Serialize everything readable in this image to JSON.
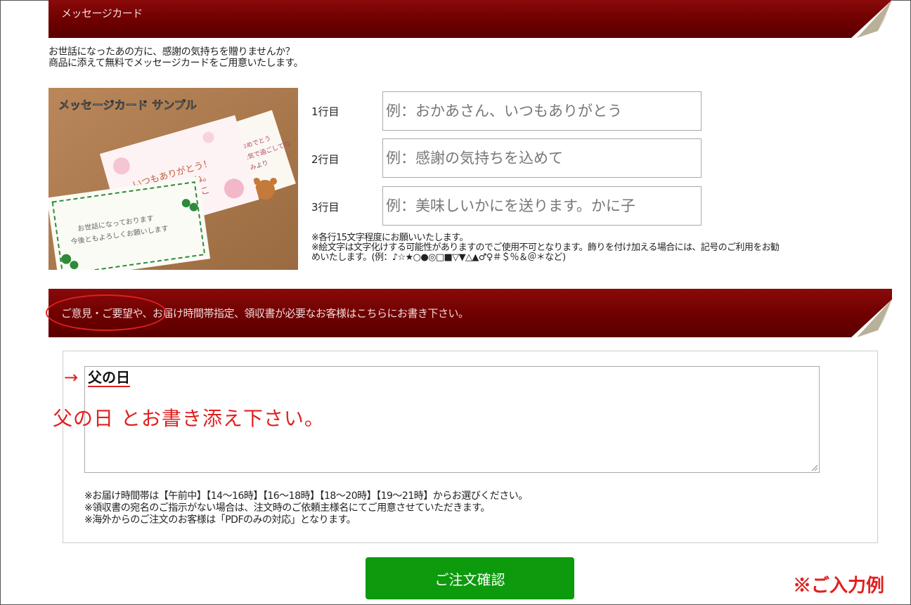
{
  "message_card": {
    "header": "メッセージカード",
    "intro_lines": [
      "お世話になったあの方に、感謝の気持ちを贈りませんか？",
      "商品に添えて無料でメッセージカードをご用意いたします。"
    ],
    "sample_image": {
      "title": "メッセージカード サンプル",
      "card_texts": [
        "いつもありがとう！",
        "みんなで食べてね。",
        "さとみ＆ゆみこ",
        "お世話になっております",
        "今後ともよろしくお願いします",
        "お誕生日おめでとう",
        "これからも元気で過ごしてね",
        "はるみより"
      ]
    },
    "lines": [
      {
        "label": "1行目",
        "placeholder": "例：おかあさん、いつもありがとう"
      },
      {
        "label": "2行目",
        "placeholder": "例：感謝の気持ちを込めて"
      },
      {
        "label": "3行目",
        "placeholder": "例：美味しいかにを送ります。かに子"
      }
    ],
    "notes": [
      "※各行15文字程度にお願いいたします。",
      "※絵文字は文字化けする可能性がありますのでご使用不可となります。飾りを付け加える場合には、記号のご利用をお勧",
      "めいたします。(例：♪☆★○●◎□■▽▼△▲♂♀＃＄％＆＠＊など)"
    ]
  },
  "comments": {
    "header": "ご意見・ご要望や、お届け時間帯指定、領収書が必要なお客様はこちらにお書き下さい。",
    "arrow": "→",
    "example_text": "父の日",
    "instruction": "父の日 とお書き添え下さい。",
    "notes": [
      "※お届け時間帯は【午前中】【14～16時】【16～18時】【18～20時】【19～21時】からお選びください。",
      "※領収書の宛名のご指示がない場合は、注文時のご依頼主様名にてご用意させていただきます。",
      "※海外からのご注文のお客様は「PDFのみの対応」となります。"
    ]
  },
  "order_button": "ご注文確認",
  "input_example_label": "※ご入力例",
  "colors": {
    "band": "#6e0000",
    "accent_red": "#e02020",
    "button_green": "#0d9a0d"
  }
}
